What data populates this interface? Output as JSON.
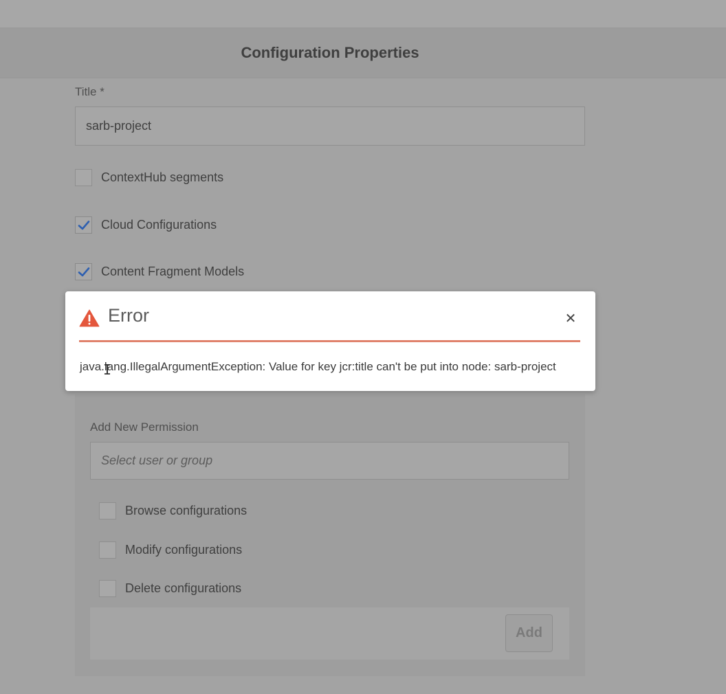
{
  "header": {
    "title": "Configuration Properties"
  },
  "form": {
    "title_label": "Title *",
    "title_value": "sarb-project",
    "options": [
      {
        "label": "ContextHub segments",
        "checked": false
      },
      {
        "label": "Cloud Configurations",
        "checked": true
      },
      {
        "label": "Content Fragment Models",
        "checked": true
      }
    ]
  },
  "permissions": {
    "add_label": "Add New Permission",
    "select_placeholder": "Select user or group",
    "options": [
      {
        "label": "Browse configurations",
        "checked": false
      },
      {
        "label": "Modify configurations",
        "checked": false
      },
      {
        "label": "Delete configurations",
        "checked": false
      }
    ],
    "add_button": "Add"
  },
  "dialog": {
    "title": "Error",
    "message": "java.lang.IllegalArgumentException: Value for key jcr:title can't be put into node: sarb-project",
    "close_icon": "close-icon",
    "warning_icon": "warning-icon",
    "accent_color": "#e0826c"
  },
  "colors": {
    "checkmark": "#2d5fb0",
    "warning": "#e4573d"
  }
}
